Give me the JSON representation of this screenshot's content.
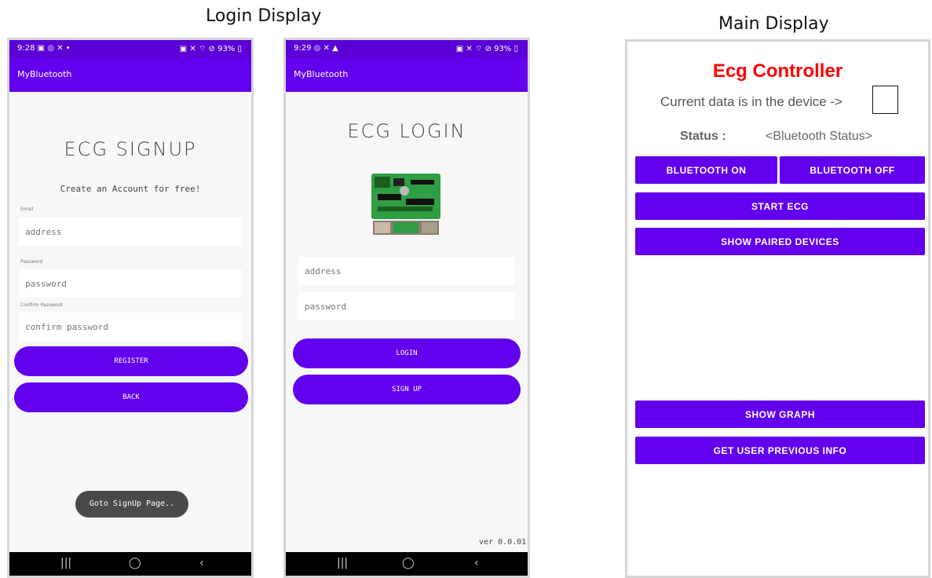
{
  "captions": {
    "login": "Login Display",
    "main": "Main Display"
  },
  "signup_phone": {
    "status_left": "9:28 ▣ ◎ ✕ •",
    "status_right": "▣ ✕ ⌔ ⊘ 93% ▯",
    "app_title": "MyBluetooth",
    "page_title": "ECG SIGNUP",
    "subtitle": "Create an Account for free!",
    "email_label": "Email",
    "email_placeholder": "address",
    "password_label": "Password",
    "password_placeholder": "password",
    "confirm_label": "Confirm Password",
    "confirm_placeholder": "confirm password",
    "register_label": "REGISTER",
    "back_label": "BACK",
    "toast": "Goto SignUp Page.."
  },
  "login_phone": {
    "status_left": "9:29 ◎ ✕ ▲",
    "status_right": "▣ ✕ ⌔ ⊘ 93% ▯",
    "app_title": "MyBluetooth",
    "page_title": "ECG LOGIN",
    "address_placeholder": "address",
    "password_placeholder": "password",
    "login_label": "LOGIN",
    "signup_label": "SIGN UP",
    "version": "ver 0.0.01"
  },
  "nav": {
    "recents": "|||",
    "home": "◯",
    "back": "‹"
  },
  "main": {
    "title": "Ecg Controller",
    "current_data_label": "Current data is in the device ->",
    "status_label": "Status :",
    "status_value": "<Bluetooth Status>",
    "bt_on": "BLUETOOTH ON",
    "bt_off": "BLUETOOTH OFF",
    "start_ecg": "START ECG",
    "show_paired": "SHOW PAIRED DEVICES",
    "show_graph": "SHOW GRAPH",
    "get_prev": "GET USER PREVIOUS INFO"
  },
  "colors": {
    "primary": "#6200ee",
    "status_bar": "#5b00d6",
    "title_red": "#ff0000"
  }
}
